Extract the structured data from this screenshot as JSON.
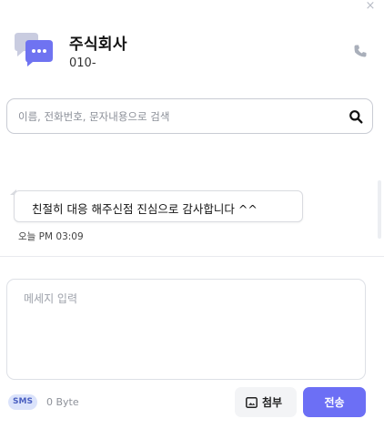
{
  "header": {
    "contact_name": "주식회사",
    "contact_phone": "010-",
    "close_symbol": "×"
  },
  "search": {
    "placeholder": "이름, 전화번호, 문자내용으로 검색",
    "value": ""
  },
  "messages": [
    {
      "text": "친절히 대응 해주신점 진심으로 감사합니다 ^^",
      "time": "오늘 PM 03:09"
    }
  ],
  "compose": {
    "placeholder": "메세지 입력",
    "value": ""
  },
  "footer": {
    "type_badge": "SMS",
    "byte_count": "0 Byte",
    "attach_label": "첨부",
    "send_label": "전송"
  },
  "icons": {
    "chat": "chat-bubbles-icon",
    "call": "phone-icon",
    "search": "search-icon",
    "attach": "image-icon",
    "close": "close-icon"
  },
  "colors": {
    "accent": "#6c6ff5",
    "avatar_front": "#6f73f1",
    "avatar_back": "#c9cce0",
    "sms_badge_bg": "#dbe3fb",
    "sms_badge_text": "#4a5fc1"
  }
}
